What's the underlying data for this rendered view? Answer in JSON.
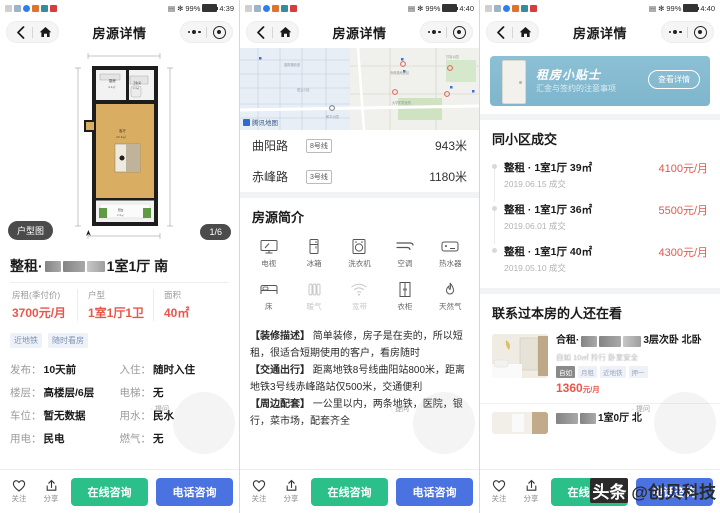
{
  "app": {
    "nav_title": "房源详情",
    "icons": {
      "back": "chevron-left-icon",
      "home": "home-icon",
      "more": "ellipsis-icon",
      "target": "target-icon"
    }
  },
  "status_bars": [
    {
      "time": "4:39",
      "battery": "99%"
    },
    {
      "time": "4:40",
      "battery": "99%"
    },
    {
      "time": "4:40",
      "battery": "99%"
    }
  ],
  "panel1": {
    "floorplan_chip": "户型图",
    "image_counter": "1/6",
    "floorplan_rooms": [
      {
        "name": "厨房",
        "area": "4.2m²"
      },
      {
        "name": "卫生间",
        "area": "2.4m²"
      },
      {
        "name": "客厅",
        "area": "20.6m²"
      },
      {
        "name": "阳台",
        "area": "2.4m²"
      }
    ],
    "title_prefix": "整租·",
    "title_suffix": "1室1厅 南",
    "specs": [
      {
        "key": "房租(季付价)",
        "value": "3700元/月"
      },
      {
        "key": "户型",
        "value": "1室1厅1卫"
      },
      {
        "key": "面积",
        "value": "40㎡"
      }
    ],
    "tags": [
      "近地铁",
      "随时看房"
    ],
    "info": [
      {
        "k": "发布：",
        "v": "10天前"
      },
      {
        "k": "入住：",
        "v": "随时入住"
      },
      {
        "k": "楼层：",
        "v": "高楼层/6层"
      },
      {
        "k": "电梯：",
        "v": "无"
      },
      {
        "k": "车位：",
        "v": "暂无数据"
      },
      {
        "k": "用水：",
        "v": "民水"
      },
      {
        "k": "用电：",
        "v": "民电"
      },
      {
        "k": "燃气：",
        "v": "无"
      }
    ],
    "bottom": {
      "fav_label": "关注",
      "share_label": "分享",
      "primary": "在线咨询",
      "secondary": "电话咨询"
    }
  },
  "panel2": {
    "map_attribution": "腾讯地图",
    "metro": [
      {
        "station": "曲阳路",
        "line": "8号线",
        "distance": "943米"
      },
      {
        "station": "赤峰路",
        "line": "3号线",
        "distance": "1180米"
      }
    ],
    "section_title": "房源简介",
    "facilities": [
      {
        "label": "电视",
        "icon": "tv-icon",
        "available": true
      },
      {
        "label": "冰箱",
        "icon": "fridge-icon",
        "available": true
      },
      {
        "label": "洗衣机",
        "icon": "washer-icon",
        "available": true
      },
      {
        "label": "空调",
        "icon": "air-conditioner-icon",
        "available": true
      },
      {
        "label": "热水器",
        "icon": "water-heater-icon",
        "available": true
      },
      {
        "label": "床",
        "icon": "bed-icon",
        "available": true
      },
      {
        "label": "暖气",
        "icon": "radiator-icon",
        "available": false
      },
      {
        "label": "宽带",
        "icon": "wifi-icon",
        "available": false
      },
      {
        "label": "衣柜",
        "icon": "wardrobe-icon",
        "available": true
      },
      {
        "label": "天然气",
        "icon": "gas-flame-icon",
        "available": true
      }
    ],
    "description": [
      {
        "head": "【装修描述】",
        "body": "简单装修，房子是在卖的，所以短租，很适合短期使用的客户，看房随时"
      },
      {
        "head": "【交通出行】",
        "body": "距离地铁8号线曲阳站800米，距离地铁3号线赤峰路站仅500米，交通便利"
      },
      {
        "head": "【周边配套】",
        "body": "一公里以内，两条地铁，医院，银行，菜市场，配套齐全"
      }
    ],
    "bottom": {
      "fav_label": "关注",
      "share_label": "分享",
      "primary": "在线咨询",
      "secondary": "电话咨询"
    }
  },
  "panel3": {
    "banner": {
      "title": "租房小贴士",
      "subtitle": "汇金与签约的注意事项",
      "button": "查看详情"
    },
    "deals_title": "同小区成交",
    "deals": [
      {
        "desc": "整租 · 1室1厅 39㎡",
        "date": "2019.06.15 成交",
        "price": "4100元/月"
      },
      {
        "desc": "整租 · 1室1厅 36㎡",
        "date": "2019.06.01 成交",
        "price": "5500元/月"
      },
      {
        "desc": "整租 · 1室1厅 40㎡",
        "date": "2019.05.10 成交",
        "price": "4300元/月"
      }
    ],
    "rec_title": "联系过本房的人还在看",
    "recommendations": [
      {
        "prefix": "合租·",
        "suffix": "3层次卧 北卧",
        "sub": "自如 10㎡ 拎行 卧室安全",
        "tags": [
          "自如",
          "月租",
          "近地铁",
          "押一"
        ],
        "price": "1360",
        "unit": "元/月"
      },
      {
        "prefix": "",
        "suffix": "1室0厅 北",
        "sub": "",
        "tags": [],
        "price": "",
        "unit": ""
      }
    ],
    "bottom": {
      "fav_label": "关注",
      "share_label": "分享",
      "primary": "在线咨询",
      "secondary": "电话咨询"
    }
  },
  "watermark": {
    "logo": "头条",
    "handle": "@创贝科技"
  },
  "colors": {
    "accent_red": "#e8564a",
    "green": "#2bbf8a",
    "blue": "#4a72e0",
    "tag_blue": "#7c93b5"
  }
}
